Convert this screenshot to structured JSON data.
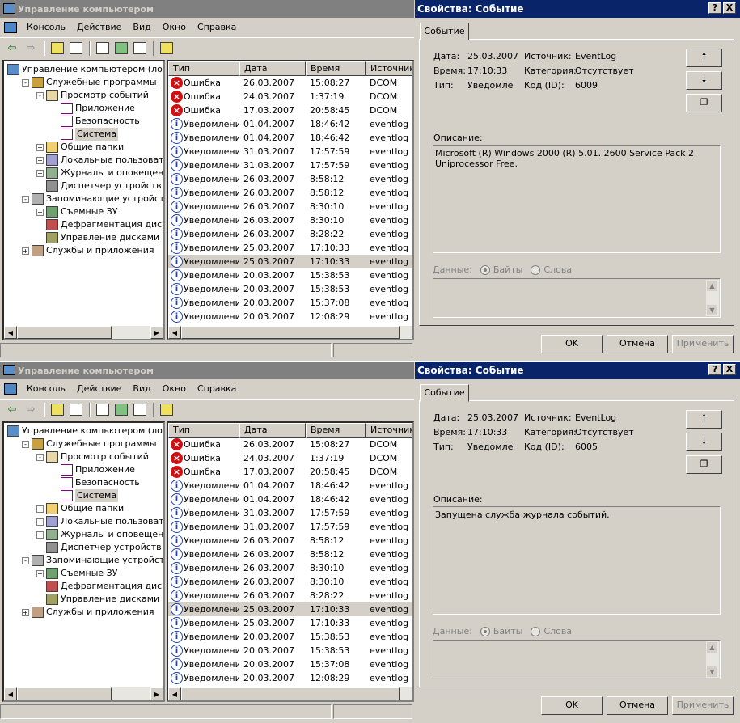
{
  "mmc": {
    "title": "Управление компьютером",
    "menu": [
      "Консоль",
      "Действие",
      "Вид",
      "Окно",
      "Справка"
    ],
    "tree": [
      {
        "label": "Управление компьютером (локаль",
        "level": 0,
        "exp": "",
        "icon": "mon"
      },
      {
        "label": "Служебные программы",
        "level": 1,
        "exp": "-",
        "icon": "tools"
      },
      {
        "label": "Просмотр событий",
        "level": 2,
        "exp": "-",
        "icon": "ev"
      },
      {
        "label": "Приложение",
        "level": 3,
        "exp": "",
        "icon": "log"
      },
      {
        "label": "Безопасность",
        "level": 3,
        "exp": "",
        "icon": "log"
      },
      {
        "label": "Система",
        "level": 3,
        "exp": "",
        "icon": "log",
        "selected": true
      },
      {
        "label": "Общие папки",
        "level": 2,
        "exp": "+",
        "icon": "fold"
      },
      {
        "label": "Локальные пользователи и",
        "level": 2,
        "exp": "+",
        "icon": "usr"
      },
      {
        "label": "Журналы и оповещения пр",
        "level": 2,
        "exp": "+",
        "icon": "perf"
      },
      {
        "label": "Диспетчер устройств",
        "level": 2,
        "exp": "",
        "icon": "dev"
      },
      {
        "label": "Запоминающие устройства",
        "level": 1,
        "exp": "-",
        "icon": "stor"
      },
      {
        "label": "Съемные ЗУ",
        "level": 2,
        "exp": "+",
        "icon": "rem"
      },
      {
        "label": "Дефрагментация диска",
        "level": 2,
        "exp": "",
        "icon": "defr"
      },
      {
        "label": "Управление дисками",
        "level": 2,
        "exp": "",
        "icon": "disk"
      },
      {
        "label": "Службы и приложения",
        "level": 1,
        "exp": "+",
        "icon": "svc"
      }
    ],
    "columns": [
      "Тип",
      "Дата",
      "Время",
      "Источник"
    ],
    "rows": [
      {
        "type": "Ошибка",
        "kind": "error",
        "date": "26.03.2007",
        "time": "15:08:27",
        "source": "DCOM"
      },
      {
        "type": "Ошибка",
        "kind": "error",
        "date": "24.03.2007",
        "time": "1:37:19",
        "source": "DCOM"
      },
      {
        "type": "Ошибка",
        "kind": "error",
        "date": "17.03.2007",
        "time": "20:58:45",
        "source": "DCOM"
      },
      {
        "type": "Уведомление",
        "kind": "info",
        "date": "01.04.2007",
        "time": "18:46:42",
        "source": "eventlog"
      },
      {
        "type": "Уведомление",
        "kind": "info",
        "date": "01.04.2007",
        "time": "18:46:42",
        "source": "eventlog"
      },
      {
        "type": "Уведомление",
        "kind": "info",
        "date": "31.03.2007",
        "time": "17:57:59",
        "source": "eventlog"
      },
      {
        "type": "Уведомление",
        "kind": "info",
        "date": "31.03.2007",
        "time": "17:57:59",
        "source": "eventlog"
      },
      {
        "type": "Уведомление",
        "kind": "info",
        "date": "26.03.2007",
        "time": "8:58:12",
        "source": "eventlog"
      },
      {
        "type": "Уведомление",
        "kind": "info",
        "date": "26.03.2007",
        "time": "8:58:12",
        "source": "eventlog"
      },
      {
        "type": "Уведомление",
        "kind": "info",
        "date": "26.03.2007",
        "time": "8:30:10",
        "source": "eventlog"
      },
      {
        "type": "Уведомление",
        "kind": "info",
        "date": "26.03.2007",
        "time": "8:30:10",
        "source": "eventlog"
      },
      {
        "type": "Уведомление",
        "kind": "info",
        "date": "26.03.2007",
        "time": "8:28:22",
        "source": "eventlog"
      },
      {
        "type": "Уведомление",
        "kind": "info",
        "date": "25.03.2007",
        "time": "17:10:33",
        "source": "eventlog"
      },
      {
        "type": "Уведомление",
        "kind": "info",
        "date": "25.03.2007",
        "time": "17:10:33",
        "source": "eventlog"
      },
      {
        "type": "Уведомление",
        "kind": "info",
        "date": "20.03.2007",
        "time": "15:38:53",
        "source": "eventlog"
      },
      {
        "type": "Уведомление",
        "kind": "info",
        "date": "20.03.2007",
        "time": "15:38:53",
        "source": "eventlog"
      },
      {
        "type": "Уведомление",
        "kind": "info",
        "date": "20.03.2007",
        "time": "15:37:08",
        "source": "eventlog"
      },
      {
        "type": "Уведомление",
        "kind": "info",
        "date": "20.03.2007",
        "time": "12:08:29",
        "source": "eventlog"
      }
    ]
  },
  "dialog": {
    "title": "Свойства: Событие",
    "help_btn": "?",
    "close_btn": "X",
    "tab": "Событие",
    "date_label": "Дата:",
    "time_label": "Время:",
    "type_label": "Тип:",
    "source_label": "Источник:",
    "category_label": "Категория:",
    "id_label": "Код (ID):",
    "date": "25.03.2007",
    "time": "17:10:33",
    "type": "Уведомле",
    "source": "EventLog",
    "category": "Отсутствует",
    "description_label": "Описание:",
    "data_label": "Данные:",
    "bytes_label": "Байты",
    "words_label": "Слова",
    "ok": "OK",
    "cancel": "Отмена",
    "apply": "Применить",
    "up_icon": "arrow-up-icon",
    "down_icon": "arrow-down-icon",
    "copy_icon": "copy-icon"
  },
  "panels": [
    {
      "selected_row": 13,
      "event_id": "6009",
      "description": "Microsoft (R) Windows 2000 (R) 5.01. 2600 Service Pack 2 Uniprocessor Free."
    },
    {
      "selected_row": 12,
      "event_id": "6005",
      "description": "Запущена служба журнала событий."
    }
  ]
}
